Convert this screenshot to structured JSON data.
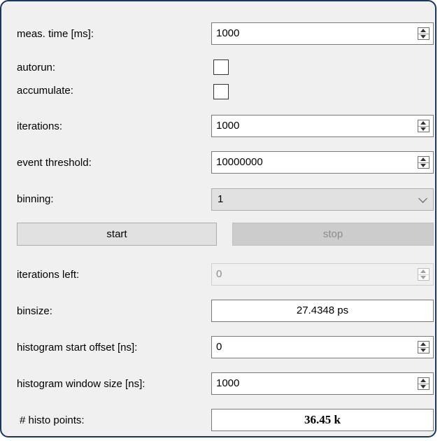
{
  "rows": {
    "meas_time": {
      "label": "meas. time [ms]:",
      "value": "1000"
    },
    "autorun": {
      "label": "autorun:",
      "checked": false
    },
    "accumulate": {
      "label": "accumulate:",
      "checked": false
    },
    "iterations": {
      "label": "iterations:",
      "value": "1000"
    },
    "event_threshold": {
      "label": "event threshold:",
      "value": "10000000"
    },
    "binning": {
      "label": "binning:",
      "value": "1"
    },
    "iterations_left": {
      "label": "iterations left:",
      "value": "0"
    },
    "binsize": {
      "label": "binsize:",
      "value": "27.4348 ps"
    },
    "hist_start_offset": {
      "label": "histogram start offset [ns]:",
      "value": "0"
    },
    "hist_window_size": {
      "label": "histogram window size [ns]:",
      "value": "1000"
    },
    "histo_points": {
      "label": "# histo points:",
      "value": "36.45 k"
    }
  },
  "buttons": {
    "start": "start",
    "stop": "stop"
  },
  "icons": {
    "spin": "spinbox-arrows-icon",
    "dropdown": "chevron-down-icon"
  },
  "colors": {
    "frame_border": "#17375e",
    "panel_bg": "#f0f0f0",
    "disabled_text": "#8c8c8c"
  }
}
